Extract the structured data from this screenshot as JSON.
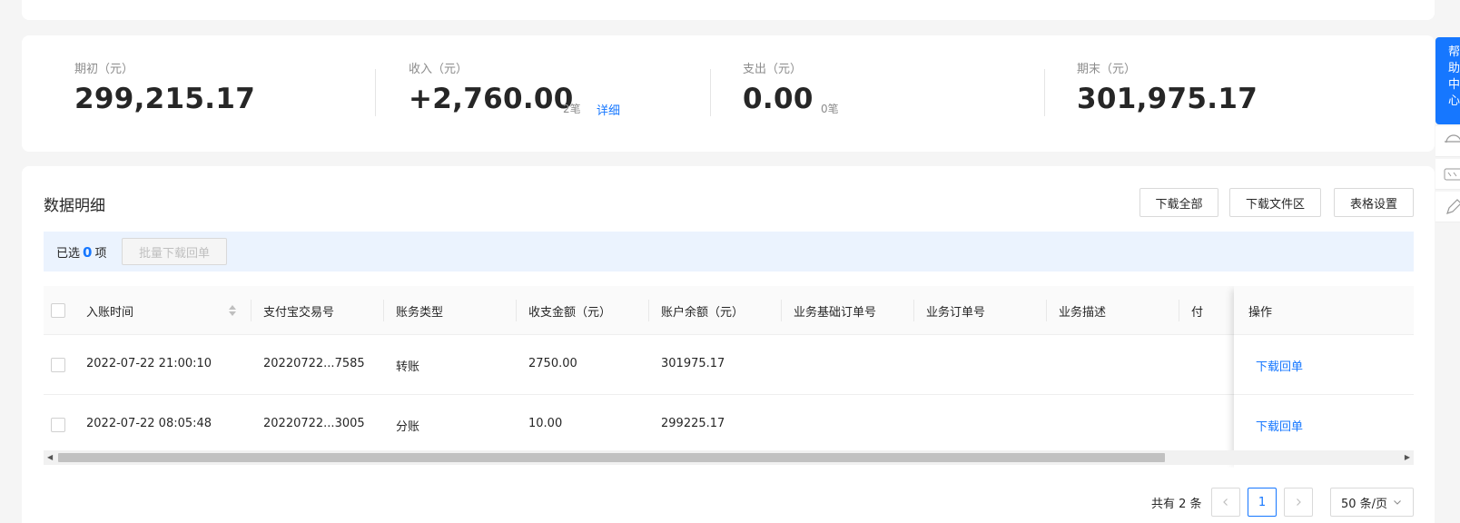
{
  "summary": {
    "opening": {
      "label": "期初（元）",
      "value": "299,215.17"
    },
    "income": {
      "label": "收入（元）",
      "value": "+2,760.00",
      "count": "2笔",
      "link": "详细"
    },
    "expense": {
      "label": "支出（元）",
      "value": "0.00",
      "count": "0笔"
    },
    "closing": {
      "label": "期末（元）",
      "value": "301,975.17"
    }
  },
  "detail": {
    "title": "数据明细",
    "buttons": [
      "下载全部",
      "下载文件区",
      "表格设置"
    ],
    "selection": {
      "prefix": "已选",
      "count": "0",
      "suffix": "项",
      "batch_button": "批量下载回单"
    }
  },
  "table": {
    "columns": [
      "入账时间",
      "支付宝交易号",
      "账务类型",
      "收支金额（元）",
      "账户余额（元）",
      "业务基础订单号",
      "业务订单号",
      "业务描述",
      "付",
      "操作"
    ],
    "rows": [
      {
        "time": "2022-07-22 21:00:10",
        "trade_no": "20220722...7585",
        "type": "转账",
        "amount": "2750.00",
        "balance": "301975.17",
        "action": "下载回单"
      },
      {
        "time": "2022-07-22 08:05:48",
        "trade_no": "20220722...3005",
        "type": "分账",
        "amount": "10.00",
        "balance": "299225.17",
        "action": "下载回单"
      }
    ]
  },
  "pagination": {
    "total": "共有 2 条",
    "current": "1",
    "page_size": "50 条/页"
  },
  "help": {
    "chars": [
      "帮",
      "助",
      "中",
      "心"
    ]
  },
  "icons": {
    "sort": "sort-icon",
    "prev": "chevron-left-icon",
    "next": "chevron-right-icon",
    "dropdown": "chevron-down-icon"
  }
}
